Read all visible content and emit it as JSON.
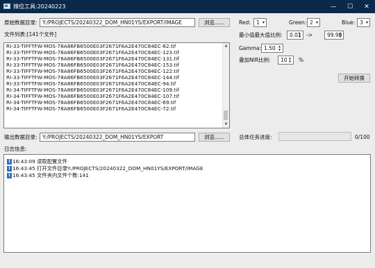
{
  "window": {
    "title": "辣位工具:20240223",
    "controls": {
      "minimize": "—",
      "maximize": "☐",
      "close": "✕"
    }
  },
  "source": {
    "label": "原始数据目录:",
    "path": "Y:/PROJECTS/20240322_DOM_HN01YS/EXPORT/IMAGE",
    "browse_label": "浏览......"
  },
  "file_list": {
    "label": "文件列表:[141个文件]",
    "items": [
      "RI-33-TIFFTFW-MOS-78A86FB6500E03F2671F6A2E470C84EC-82.tif",
      "RI-33-TIFFTFW-MOS-78A86FB6500E03F2671F6A2E470C84EC-123.tif",
      "RI-33-TIFFTFW-MOS-78A86FB6500E03F2671F6A2E470C84EC-131.tif",
      "RI-33-TIFFTFW-MOS-78A86FB6500E03F2671F6A2E470C84EC-153.tif",
      "RI-33-TIFFTFW-MOS-78A86FB6500E03F2671F6A2E470C84EC-122.tif",
      "RI-33-TIFFTFW-MOS-78A86FB6500E03F2671F6A2E470C84EC-144.tif",
      "RI-33-TIFFTFW-MOS-78A86FB6500E03F2671F6A2E470C84EC-94.tif",
      "RI-34-TIFFTFW-MOS-78A86FB6500E03F2671F6A2E470C84EC-109.tif",
      "RI-34-TIFFTFW-MOS-78A86FB6500E03F2671F6A2E470C84EC-107.tif",
      "RI-34-TIFFTFW-MOS-78A86FB6500E03F2671F6A2E470C84EC-69.tif",
      "RI-34-TIFFTFW-MOS-78A86FB6500E03F2671F6A2E470C84EC-72.tif"
    ]
  },
  "output": {
    "label": "输出数据目录:",
    "path": "Y:/PROJECTS/20240322_DOM_HN01YS/EXPORT",
    "browse_label": "浏览......"
  },
  "bands": {
    "red_label": "Red:",
    "red_value": "1",
    "green_label": "Green:",
    "green_value": "2",
    "blue_label": "Blue:",
    "blue_value": "3"
  },
  "stretch": {
    "label": "最小值最大值比例:",
    "min": "0.01",
    "separator": "->",
    "max": "99.99"
  },
  "gamma": {
    "label": "Gamma:",
    "value": "1.50"
  },
  "nir": {
    "label": "叠加NIR比例:",
    "value": "10",
    "unit": "%"
  },
  "convert_button": "开始转换",
  "progress": {
    "label": "总体任务进度:",
    "text": "0/100",
    "fraction": 0
  },
  "log": {
    "label": "日志信息:",
    "entries": [
      {
        "time": "16:43:09",
        "message": "读取配置文件"
      },
      {
        "time": "16:43:45",
        "message": "打开文件目录Y:/PROJECTS/20240322_DOM_HN01YS/EXPORT/IMAGE"
      },
      {
        "time": "16:43:45",
        "message": "文件夹内文件个数:141"
      }
    ]
  },
  "colors": {
    "titlebar": "#0b2a4a",
    "progress_fill": "#06b025",
    "info_icon": "#2f6fb9"
  }
}
